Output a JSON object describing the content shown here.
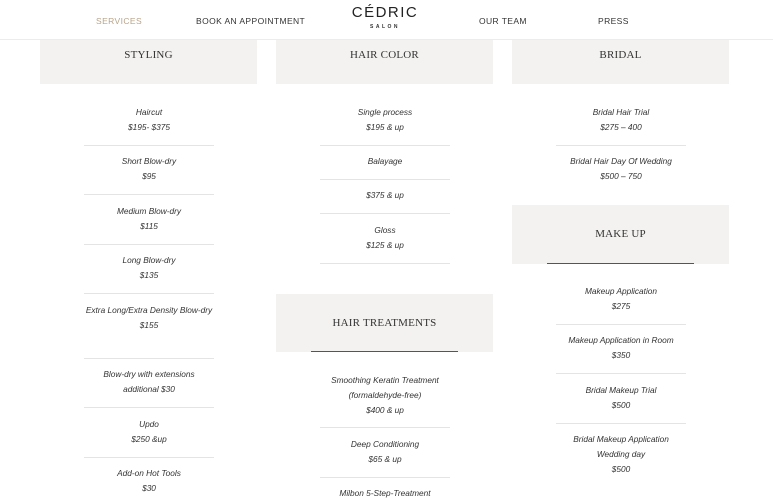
{
  "nav": {
    "services": "SERVICES",
    "book": "BOOK AN APPOINTMENT",
    "logo": "CÉDRIC",
    "logo_sub": "SALON",
    "team": "OUR TEAM",
    "press": "PRESS",
    "active_color": "#b9a48a"
  },
  "styling": {
    "title": "STYLING",
    "items": [
      {
        "name": "Haircut",
        "price": "$195- $375"
      },
      {
        "name": "Short Blow-dry",
        "price": "$95"
      },
      {
        "name": "Medium Blow-dry",
        "price": "$115"
      },
      {
        "name": "Long Blow-dry",
        "price": "$135"
      },
      {
        "name": "Extra Long/Extra Density Blow-dry",
        "price": "$155"
      },
      {
        "name": "Blow-dry with extensions additional $30",
        "price": ""
      },
      {
        "name": "Updo",
        "price": "$250 &up"
      },
      {
        "name": "Add-on Hot Tools",
        "price": "$30"
      }
    ]
  },
  "hair_color": {
    "title": "HAIR COLOR",
    "items": [
      {
        "name": "Single process",
        "price": "$195 & up"
      },
      {
        "name": "Balayage",
        "price": ""
      },
      {
        "name": "$375 & up",
        "price": ""
      },
      {
        "name": "Gloss",
        "price": "$125 & up"
      }
    ]
  },
  "hair_treatments": {
    "title": "HAIR TREATMENTS",
    "items": [
      {
        "name": "Smoothing Keratin Treatment (formaldehyde-free)",
        "price": "$400 & up"
      },
      {
        "name": "Deep Conditioning",
        "price": "$65 & up"
      },
      {
        "name": "Milbon 5-Step-Treatment",
        "price": ""
      }
    ]
  },
  "bridal": {
    "title": "BRIDAL",
    "items": [
      {
        "name": "Bridal Hair Trial",
        "price": "$275 – 400"
      },
      {
        "name": "Bridal Hair Day Of Wedding",
        "price": "$500 – 750"
      }
    ]
  },
  "make_up": {
    "title": "MAKE UP",
    "items": [
      {
        "name": "Makeup Application",
        "price": "$275"
      },
      {
        "name": "Makeup Application in Room",
        "price": "$350"
      },
      {
        "name": "Bridal Makeup Trial",
        "price": "$500"
      },
      {
        "name": "Bridal Makeup Application Wedding day",
        "price": "$500"
      }
    ]
  }
}
